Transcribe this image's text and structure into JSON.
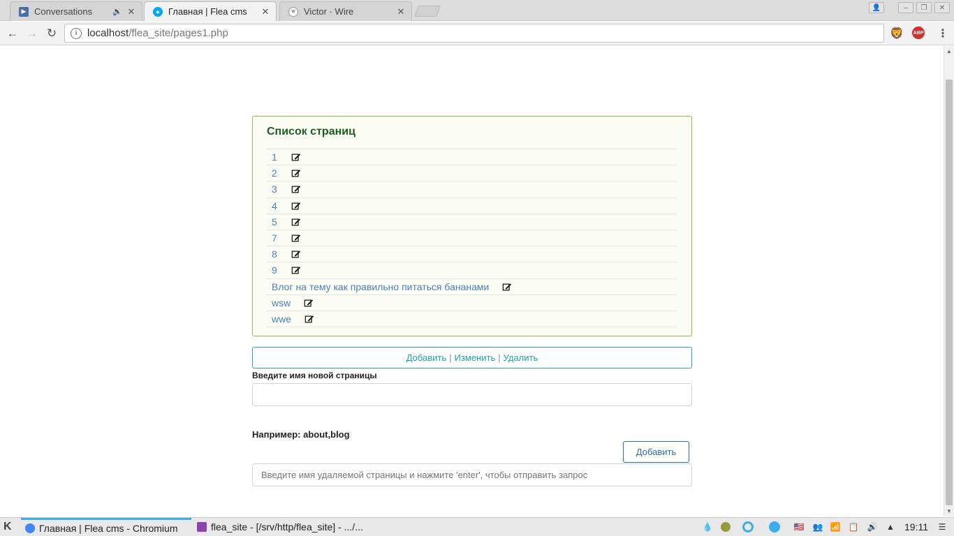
{
  "browser": {
    "tabs": [
      {
        "title": "Conversations",
        "active": false
      },
      {
        "title": "Главная | Flea cms",
        "active": true
      },
      {
        "title": "Victor · Wire",
        "active": false
      }
    ],
    "url_host": "localhost",
    "url_path": "/flea_site/pages1.php"
  },
  "panel": {
    "title": "Список страниц",
    "pages": [
      "1",
      "2",
      "3",
      "4",
      "5",
      "7",
      "8",
      "9",
      "Влог на тему как правильно питаться бананами",
      "wsw",
      "wwe"
    ]
  },
  "actions": {
    "add": "Добавить",
    "edit": "Изменить",
    "delete": "Удалить",
    "separator": "|"
  },
  "form": {
    "new_page_label": "Введите имя новой страницы",
    "new_page_value": "",
    "example": "Например: about,blog",
    "add_button": "Добавить",
    "delete_placeholder": "Введите имя удаляемой страницы и нажмите 'enter', чтобы отправить запрос"
  },
  "taskbar": {
    "tasks": [
      {
        "title": "Главная | Flea cms - Chromium",
        "active": true
      },
      {
        "title": "flea_site - [/srv/http/flea_site] - .../...",
        "active": false
      }
    ],
    "clock": "19:11"
  }
}
